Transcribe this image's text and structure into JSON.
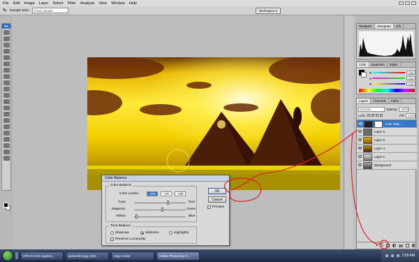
{
  "menu": {
    "items": [
      "File",
      "Edit",
      "Image",
      "Layer",
      "Select",
      "Filter",
      "Analysis",
      "View",
      "Window",
      "Help"
    ]
  },
  "options": {
    "sample_size_label": "Sample Size:",
    "sample_size_value": "Point Sample",
    "workspace_label": "Workspace ▾"
  },
  "toolbox": {
    "title": "Ps"
  },
  "dialog": {
    "title": "Color Balance",
    "group_color": "Color Balance",
    "color_levels_label": "Color Levels:",
    "levels": [
      "-100",
      "+18",
      "-100"
    ],
    "sliders": [
      {
        "left": "Cyan",
        "right": "Red",
        "value": 0.66
      },
      {
        "left": "Magenta",
        "right": "Green",
        "value": 0.56
      },
      {
        "left": "Yellow",
        "right": "Blue",
        "value": 0.05
      }
    ],
    "group_tone": "Tone Balance",
    "tones": [
      "Shadows",
      "Midtones",
      "Highlights"
    ],
    "selected_tone": "Midtones",
    "preserve_label": "Preserve Luminosity",
    "ok": "OK",
    "cancel": "Cancel",
    "preview": "Preview"
  },
  "nav_panel": {
    "tabs": [
      "Navigator",
      "Histogram",
      "Info"
    ],
    "active": "Histogram"
  },
  "color_panel": {
    "tabs": [
      "Color",
      "Swatches",
      "Styles"
    ],
    "active": "Color",
    "channels": [
      "R",
      "G",
      "B"
    ],
    "values": [
      255,
      255,
      255
    ]
  },
  "layers_panel": {
    "tabs": [
      "Layers",
      "Channels",
      "Paths"
    ],
    "active": "Layers",
    "blend_mode": "Normal",
    "opacity_label": "Opacity:",
    "opacity_value": "100%",
    "lock_label": "Lock:",
    "fill_label": "Fill:",
    "fill_value": "100%",
    "layers": [
      {
        "name": "Color Bala...",
        "selected": true
      },
      {
        "name": "Layer 6",
        "selected": false
      },
      {
        "name": "Layer 5",
        "selected": false
      },
      {
        "name": "Layer 4",
        "selected": false
      },
      {
        "name": "Layer 1",
        "selected": false
      },
      {
        "name": "Background",
        "selected": false
      }
    ],
    "footer_icons": [
      "link-icon",
      "fx-icon",
      "mask-icon",
      "adjustment-icon",
      "folder-icon",
      "new-layer-icon",
      "trash-icon"
    ]
  },
  "taskbar": {
    "tasks": [
      "ZTE EV-DO Applicat...",
      "pyramids2.jpg (300...",
      "msg Center",
      "Adobe Photoshop C..."
    ],
    "active": "Adobe Photoshop C...",
    "clock": "2:09 AM"
  },
  "colors": {
    "accent": "#3576c9",
    "annotation": "#e01c24",
    "sky_top": "#f5d300",
    "sand": "#e7d300"
  }
}
